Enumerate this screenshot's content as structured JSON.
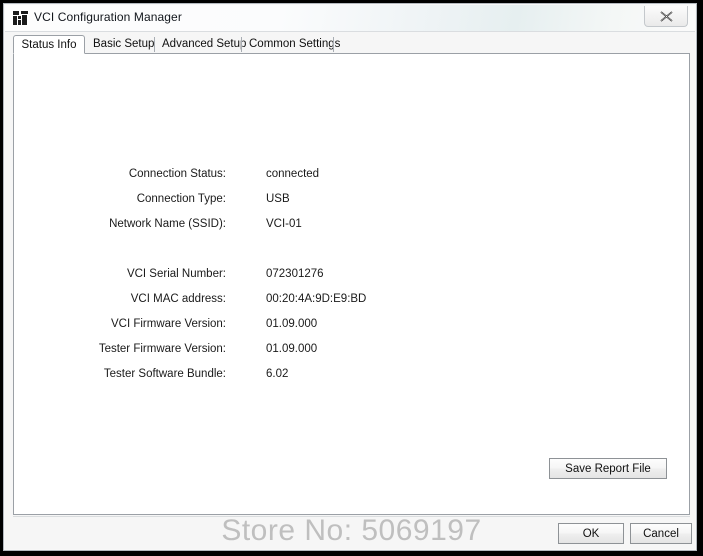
{
  "window": {
    "title": "VCI Configuration Manager",
    "icon": "app-icon",
    "close_label": "✕"
  },
  "tabs": [
    {
      "label": "Status Info",
      "active": true
    },
    {
      "label": "Basic Setup",
      "active": false
    },
    {
      "label": "Advanced Setup",
      "active": false
    },
    {
      "label": "Common Settings",
      "active": false
    }
  ],
  "status_info": {
    "group_one": [
      {
        "label": "Connection Status:",
        "value": "connected"
      },
      {
        "label": "Connection Type:",
        "value": "USB"
      },
      {
        "label": "Network Name (SSID):",
        "value": "VCI-01"
      }
    ],
    "group_two": [
      {
        "label": "VCI Serial Number:",
        "value": "072301276"
      },
      {
        "label": "VCI MAC address:",
        "value": "00:20:4A:9D:E9:BD"
      },
      {
        "label": "VCI Firmware Version:",
        "value": "01.09.000"
      },
      {
        "label": "Tester Firmware Version:",
        "value": "01.09.000"
      },
      {
        "label": "Tester Software Bundle:",
        "value": "6.02"
      }
    ],
    "save_report_label": "Save Report File"
  },
  "footer": {
    "ok_label": "OK",
    "cancel_label": "Cancel"
  },
  "watermark": {
    "text": "Store No: 5069197"
  }
}
